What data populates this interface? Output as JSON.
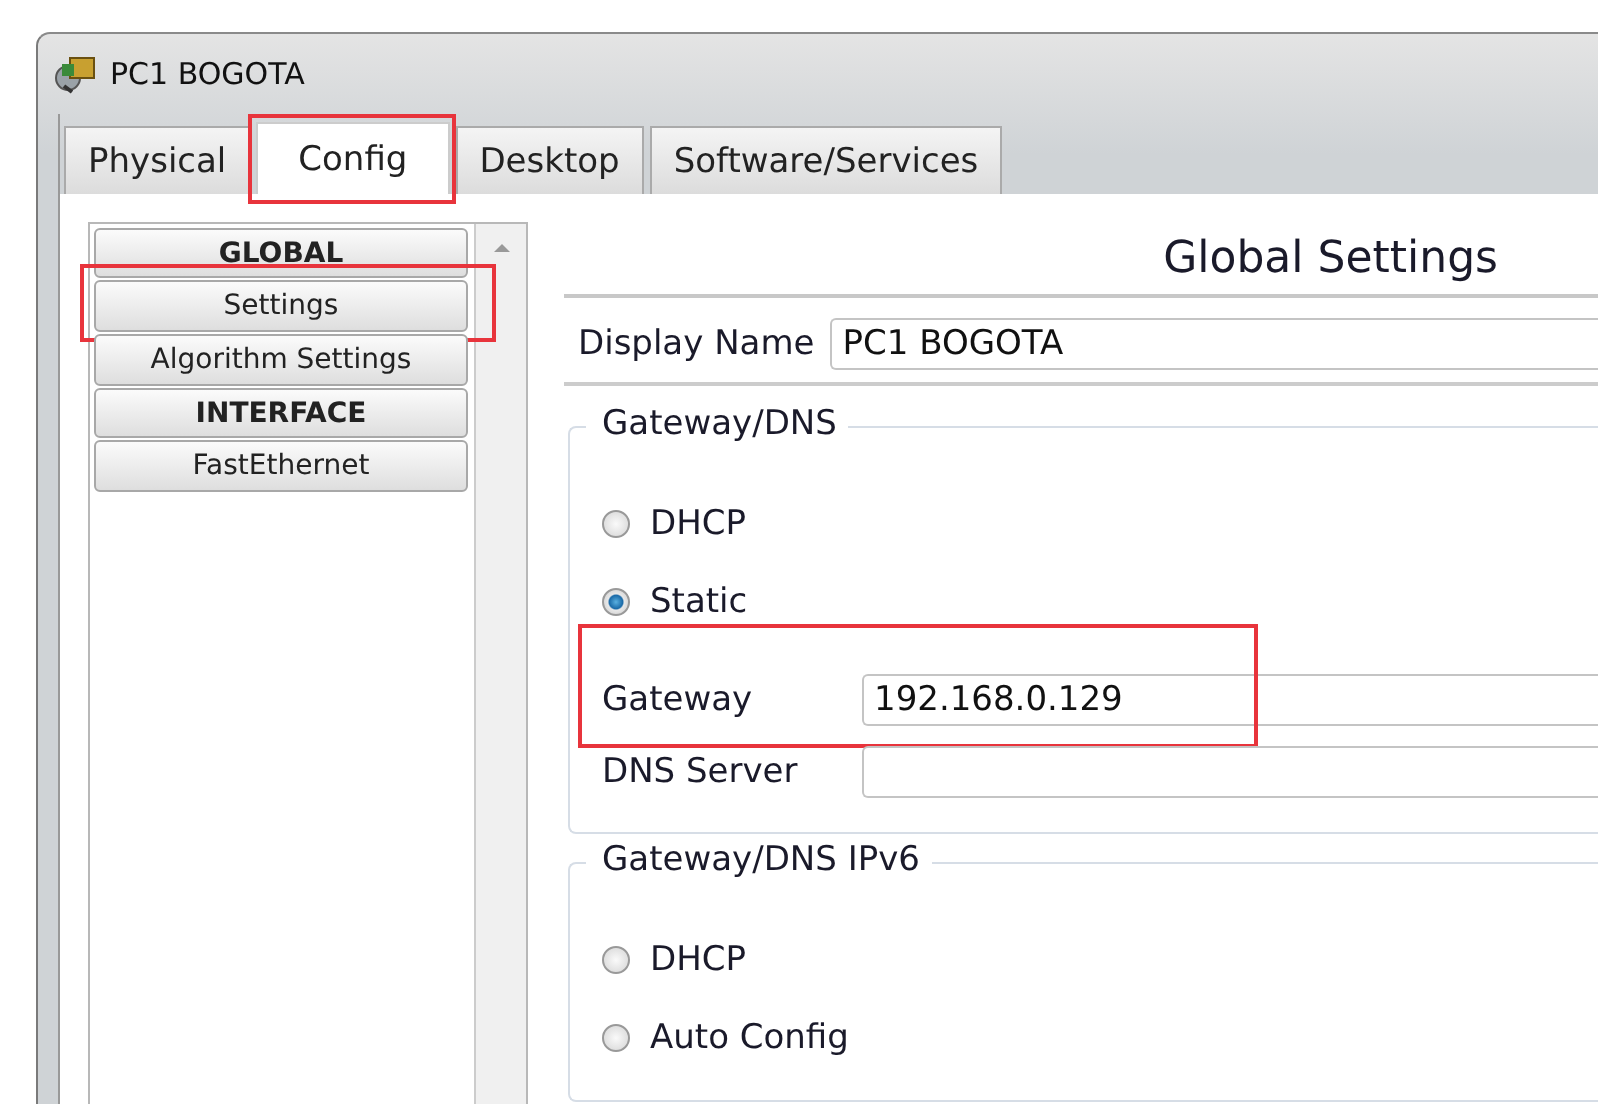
{
  "window": {
    "title": "PC1 BOGOTA"
  },
  "tabs": [
    {
      "label": "Physical",
      "selected": false,
      "highlighted": false
    },
    {
      "label": "Config",
      "selected": true,
      "highlighted": true
    },
    {
      "label": "Desktop",
      "selected": false,
      "highlighted": false
    },
    {
      "label": "Software/Services",
      "selected": false,
      "highlighted": false
    }
  ],
  "sidebar": {
    "items": [
      {
        "kind": "header",
        "label": "GLOBAL",
        "highlighted": false
      },
      {
        "kind": "item",
        "label": "Settings",
        "highlighted": true
      },
      {
        "kind": "item",
        "label": "Algorithm Settings",
        "highlighted": false
      },
      {
        "kind": "header",
        "label": "INTERFACE",
        "highlighted": false
      },
      {
        "kind": "item",
        "label": "FastEthernet",
        "highlighted": false
      }
    ]
  },
  "panel": {
    "title": "Global Settings",
    "display_name": {
      "label": "Display Name",
      "value": "PC1 BOGOTA"
    },
    "groups": [
      {
        "title": "Gateway/DNS",
        "options": [
          {
            "label": "DHCP",
            "selected": false
          },
          {
            "label": "Static",
            "selected": true
          }
        ],
        "fields": [
          {
            "label": "Gateway",
            "value": "192.168.0.129",
            "highlighted": true
          },
          {
            "label": "DNS Server",
            "highlighted": false
          }
        ]
      },
      {
        "title": "Gateway/DNS IPv6",
        "options": [
          {
            "label": "DHCP",
            "selected": false
          },
          {
            "label": "Auto Config",
            "selected": false
          }
        ]
      }
    ]
  }
}
